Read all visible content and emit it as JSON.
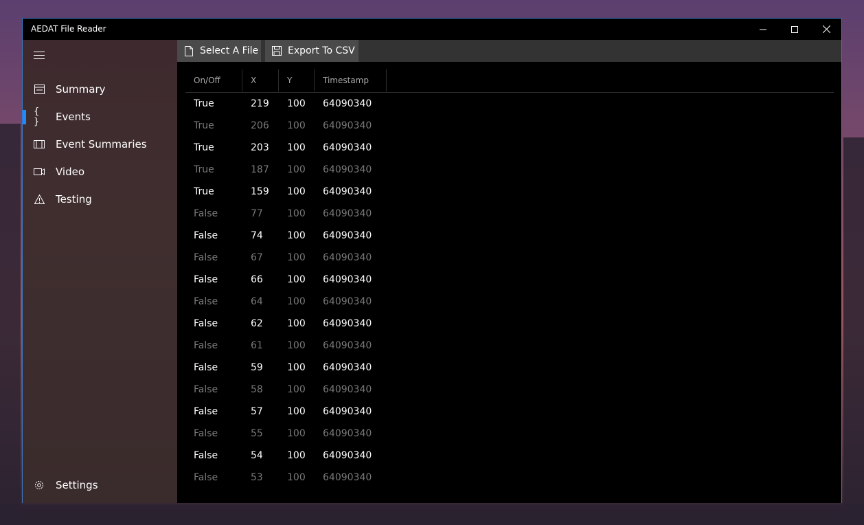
{
  "window": {
    "title": "AEDAT File Reader",
    "accent": "#1a8cff",
    "border": "#3b78c4"
  },
  "sidebar": {
    "items": [
      {
        "label": "Summary",
        "icon": "summary-icon"
      },
      {
        "label": "Events",
        "icon": "braces-icon",
        "selected": true
      },
      {
        "label": "Event Summaries",
        "icon": "film-icon"
      },
      {
        "label": "Video",
        "icon": "video-camera-icon"
      },
      {
        "label": "Testing",
        "icon": "warning-icon"
      }
    ],
    "settings_label": "Settings"
  },
  "toolbar": {
    "select_file_label": "Select A File",
    "export_csv_label": "Export To CSV"
  },
  "table": {
    "headers": [
      "On/Off",
      "X",
      "Y",
      "Timestamp"
    ],
    "rows": [
      [
        "True",
        "219",
        "100",
        "64090340"
      ],
      [
        "True",
        "206",
        "100",
        "64090340"
      ],
      [
        "True",
        "203",
        "100",
        "64090340"
      ],
      [
        "True",
        "187",
        "100",
        "64090340"
      ],
      [
        "True",
        "159",
        "100",
        "64090340"
      ],
      [
        "False",
        "77",
        "100",
        "64090340"
      ],
      [
        "False",
        "74",
        "100",
        "64090340"
      ],
      [
        "False",
        "67",
        "100",
        "64090340"
      ],
      [
        "False",
        "66",
        "100",
        "64090340"
      ],
      [
        "False",
        "64",
        "100",
        "64090340"
      ],
      [
        "False",
        "62",
        "100",
        "64090340"
      ],
      [
        "False",
        "61",
        "100",
        "64090340"
      ],
      [
        "False",
        "59",
        "100",
        "64090340"
      ],
      [
        "False",
        "58",
        "100",
        "64090340"
      ],
      [
        "False",
        "57",
        "100",
        "64090340"
      ],
      [
        "False",
        "55",
        "100",
        "64090340"
      ],
      [
        "False",
        "54",
        "100",
        "64090340"
      ],
      [
        "False",
        "53",
        "100",
        "64090340"
      ]
    ]
  }
}
